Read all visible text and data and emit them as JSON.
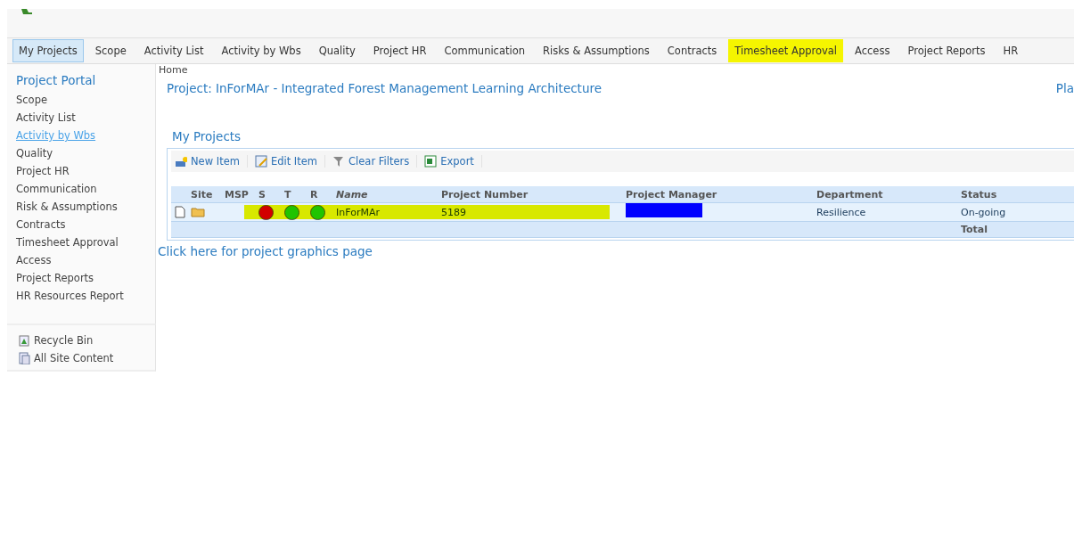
{
  "tabs": [
    {
      "label": "My Projects",
      "selected": true,
      "highlighted": false
    },
    {
      "label": "Scope",
      "selected": false,
      "highlighted": false
    },
    {
      "label": "Activity List",
      "selected": false,
      "highlighted": false
    },
    {
      "label": "Activity by Wbs",
      "selected": false,
      "highlighted": false
    },
    {
      "label": "Quality",
      "selected": false,
      "highlighted": false
    },
    {
      "label": "Project HR",
      "selected": false,
      "highlighted": false
    },
    {
      "label": "Communication",
      "selected": false,
      "highlighted": false
    },
    {
      "label": "Risks & Assumptions",
      "selected": false,
      "highlighted": false
    },
    {
      "label": "Contracts",
      "selected": false,
      "highlighted": false
    },
    {
      "label": "Timesheet Approval",
      "selected": false,
      "highlighted": true
    },
    {
      "label": "Access",
      "selected": false,
      "highlighted": false
    },
    {
      "label": "Project Reports",
      "selected": false,
      "highlighted": false
    },
    {
      "label": "HR",
      "selected": false,
      "highlighted": false
    }
  ],
  "sidebar": {
    "title": "Project Portal",
    "items": [
      {
        "label": "Scope",
        "selected": false
      },
      {
        "label": "Activity List",
        "selected": false
      },
      {
        "label": "Activity by Wbs",
        "selected": true
      },
      {
        "label": "Quality",
        "selected": false
      },
      {
        "label": "Project HR",
        "selected": false
      },
      {
        "label": "Communication",
        "selected": false
      },
      {
        "label": "Risk & Assumptions",
        "selected": false
      },
      {
        "label": "Contracts",
        "selected": false
      },
      {
        "label": "Timesheet Approval",
        "selected": false
      },
      {
        "label": "Access",
        "selected": false
      },
      {
        "label": "Project Reports",
        "selected": false
      },
      {
        "label": "HR Resources Report",
        "selected": false
      }
    ],
    "footer": [
      {
        "label": "Recycle Bin",
        "kind": "recycle"
      },
      {
        "label": "All Site Content",
        "kind": "content"
      }
    ]
  },
  "breadcrumb": "Home",
  "page_title": "Project: InForMAr - Integrated Forest Management Learning Architecture",
  "page_link": "Pla",
  "list": {
    "title": "My Projects",
    "toolbar": [
      {
        "label": "New Item",
        "kind": "new"
      },
      {
        "label": "Edit Item",
        "kind": "edit"
      },
      {
        "label": "Clear Filters",
        "kind": "filter"
      },
      {
        "label": "Export",
        "kind": "export"
      }
    ],
    "columns": [
      "",
      "Site",
      "MSP",
      "S",
      "T",
      "R",
      "Name",
      "Project Number",
      "Project Manager",
      "Department",
      "Status"
    ],
    "rows": [
      {
        "highlighted": true,
        "s": {
          "color": "#e00000"
        },
        "t": {
          "color": "#22cc00"
        },
        "r": {
          "color": "#22cc00"
        },
        "name": "InForMAr",
        "project_number": "5189",
        "project_manager": {
          "redacted": true
        },
        "department": "Resilience",
        "status": "On-going"
      }
    ],
    "total": "Total"
  },
  "graphics_link": "Click here for project graphics page"
}
